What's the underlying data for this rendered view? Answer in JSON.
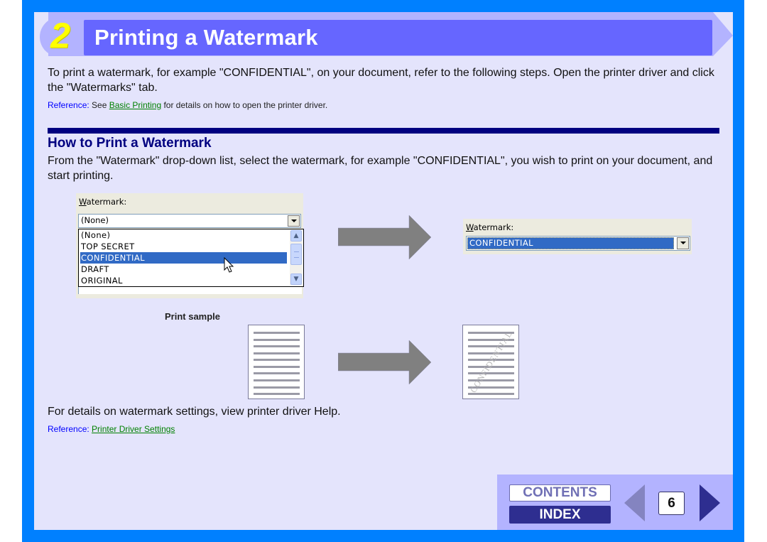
{
  "header": {
    "chapter_number": "2",
    "title": "Printing a Watermark"
  },
  "intro": {
    "text": "To print a watermark, for example \"CONFIDENTIAL\", on your document, refer to the following steps. Open the printer driver and click the \"Watermarks\" tab.",
    "reference": {
      "label": "Reference:",
      "prefix": "See",
      "link": "Basic Printing",
      "suffix": "for details on how to open the printer driver."
    }
  },
  "section": {
    "heading": "How to Print a Watermark",
    "text": "From the \"Watermark\" drop-down list, select the watermark, for example \"CONFIDENTIAL\", you wish to print on your document, and start printing."
  },
  "dropdown_before": {
    "label_accel": "W",
    "label_rest": "atermark:",
    "value": "(None)",
    "options": [
      "(None)",
      "TOP SECRET",
      "CONFIDENTIAL",
      "DRAFT",
      "ORIGINAL"
    ],
    "highlighted": "CONFIDENTIAL"
  },
  "dropdown_after": {
    "label_accel": "W",
    "label_rest": "atermark:",
    "value": "CONFIDENTIAL"
  },
  "print_sample": {
    "label": "Print sample",
    "watermark_text": "CONFIDENTIAL"
  },
  "footer": {
    "text": "For details on watermark settings, view printer driver Help.",
    "reference": {
      "label": "Reference:",
      "link": "Printer Driver Settings"
    }
  },
  "nav": {
    "contents_label": "CONTENTS",
    "index_label": "INDEX",
    "page_number": "6"
  },
  "colors": {
    "frame": "#0080ff",
    "panel": "#e4e4fc",
    "title_bar": "#6666ff",
    "title_strip": "#b3b3ff",
    "heading": "#000080",
    "link": "#008000",
    "reference": "#0000ff",
    "selection": "#316ac5"
  }
}
